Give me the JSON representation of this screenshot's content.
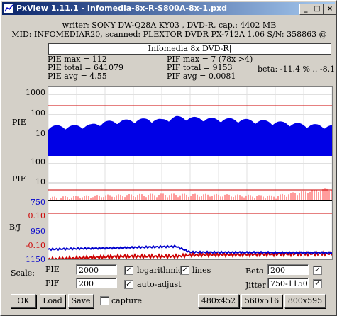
{
  "window": {
    "title": "PxView 1.11.1 - Infomedia-8x-R-S800A-8x-1.pxd"
  },
  "titlebar_buttons": {
    "minimize": "_",
    "maximize": "□",
    "close": "×"
  },
  "header": {
    "line1": "writer: SONY DW-Q28A KY03 , DVD-R, cap.: 4402 MB",
    "line2": "MID: INFOMEDIAR20, scanned: PLEXTOR DVDR PX-712A 1.06 S/N: 358863 @"
  },
  "disc_label": "Infomedia 8x DVD-R|",
  "stats": {
    "pie_max": "PIE max = 112",
    "pie_total": "PIE total = 641079",
    "pie_avg": "PIE avg = 4.55",
    "pif_max": "PIF max = 7 (78x >4)",
    "pif_total": "PIF total = 9153",
    "pif_avg": "PIF avg = 0.0081",
    "beta": "beta: -11.4 % .. -8.1 % (!"
  },
  "graph": {
    "pie_label": "PIE",
    "pif_label": "PIF",
    "bj_label": "B/J",
    "pie_ticks": [
      "1000",
      "100",
      "10"
    ],
    "pif_ticks": [
      "100",
      "10"
    ],
    "bj_ticks": [
      "750",
      "0.10",
      "950",
      "-0.10",
      "1150"
    ],
    "colors": {
      "pie": "#0000e6",
      "pif": "#ff9c9c",
      "beta": "#cc0000",
      "jitter": "#0000cc",
      "limit": "#cc0000",
      "tick_blue": "#0000cc",
      "tick_red": "#cc0000"
    }
  },
  "chart_data": {
    "type": "area",
    "series": [
      {
        "name": "PIE",
        "scale": "log",
        "ylim": [
          1,
          1000
        ],
        "x": [
          0,
          8,
          15,
          20,
          25,
          30,
          35,
          40,
          45,
          50,
          55,
          60,
          65,
          70,
          75,
          80,
          85,
          90,
          95,
          100
        ],
        "values": [
          25,
          25,
          28,
          40,
          45,
          50,
          55,
          50,
          70,
          65,
          60,
          55,
          55,
          50,
          45,
          40,
          35,
          30,
          28,
          25
        ]
      },
      {
        "name": "PIF",
        "scale": "log",
        "ylim": [
          1,
          100
        ],
        "x": [
          0,
          20,
          40,
          60,
          80,
          100
        ],
        "values": [
          1,
          1.3,
          1.5,
          1.4,
          1.2,
          3
        ]
      },
      {
        "name": "Beta",
        "ylim": [
          -0.1,
          0.1
        ],
        "x": [
          0,
          25,
          45,
          50,
          100
        ],
        "values": [
          -0.1,
          -0.09,
          -0.09,
          -0.085,
          -0.08
        ]
      },
      {
        "name": "Jitter",
        "ylim": [
          750,
          1150
        ],
        "x": [
          0,
          25,
          45,
          50,
          100
        ],
        "values": [
          1080,
          1070,
          1060,
          1100,
          1105
        ]
      }
    ]
  },
  "controls": {
    "scale_label": "Scale:",
    "pie_label": "PIE",
    "pie_value": "2000",
    "pif_label": "PIF",
    "pif_value": "200",
    "logarithmic_label": "logarithmic",
    "logarithmic_checked": "✓",
    "lines_label": "lines",
    "lines_checked": "✓",
    "auto_adjust_label": "auto-adjust",
    "auto_adjust_checked": "✓",
    "beta_label": "Beta",
    "beta_value": "200",
    "beta_checked": "✓",
    "jitter_label": "Jitter",
    "jitter_value": "750-1150",
    "jitter_checked": "✓",
    "capture_label": "capture"
  },
  "buttons": {
    "ok": "OK",
    "load": "Load",
    "save": "Save",
    "size1": "480x452",
    "size2": "560x516",
    "size3": "800x595"
  }
}
